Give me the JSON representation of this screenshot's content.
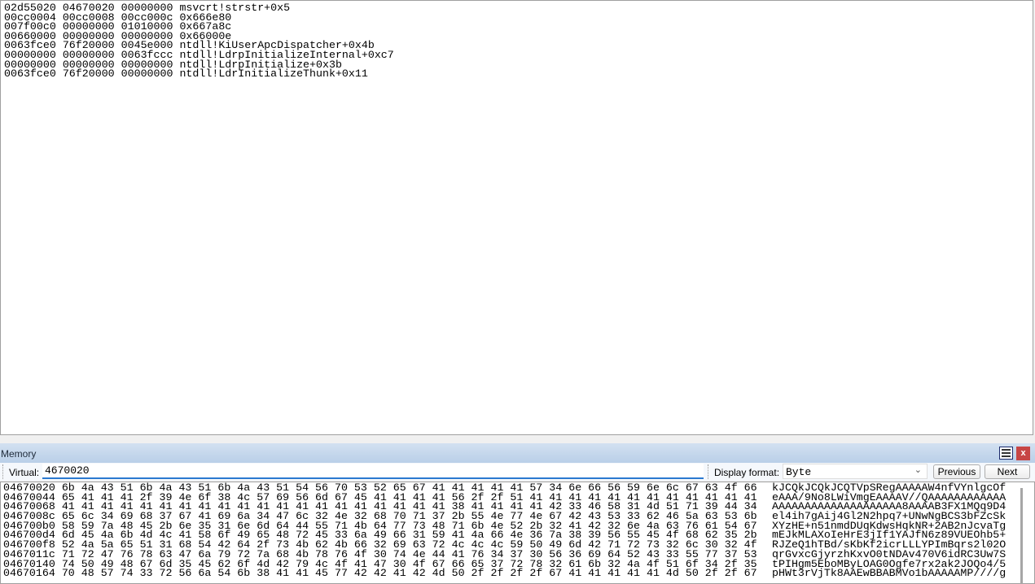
{
  "stack_pane": {
    "lines": [
      "02d55020 04670020 00000000 msvcrt!strstr+0x5",
      "00cc0004 00cc0008 00cc000c 0x666e80",
      "007f00c0 00000000 01010000 0x667a8c",
      "00660000 00000000 00000000 0x66000e",
      "0063fce0 76f20000 0045e000 ntdll!KiUserApcDispatcher+0x4b",
      "00000000 00000000 0063fccc ntdll!LdrpInitializeInternal+0xc7",
      "00000000 00000000 00000000 ntdll!LdrpInitialize+0x3b",
      "0063fce0 76f20000 00000000 ntdll!LdrInitializeThunk+0x11"
    ]
  },
  "memory_window": {
    "title": "Memory",
    "close_label": "x",
    "virtual_label": "Virtual:",
    "virtual_value": "4670020",
    "display_format_label": "Display format:",
    "display_format_value": "Byte",
    "previous_label": "Previous",
    "next_label": "Next",
    "rows": [
      {
        "addr": "04670020",
        "hex": "6b 4a 43 51 6b 4a 43 51 6b 4a 43 51 54 56 70 53 52 65 67 41 41 41 41 41 57 34 6e 66 56 59 6e 6c 67 63 4f 66",
        "ascii": "kJCQkJCQkJCQTVpSRegAAAAAW4nfVYnlgcOf"
      },
      {
        "addr": "04670044",
        "hex": "65 41 41 41 2f 39 4e 6f 38 4c 57 69 56 6d 67 45 41 41 41 41 56 2f 2f 51 41 41 41 41 41 41 41 41 41 41 41 41",
        "ascii": "eAAA/9No8LWiVmgEAAAAV//QAAAAAAAAAAAA"
      },
      {
        "addr": "04670068",
        "hex": "41 41 41 41 41 41 41 41 41 41 41 41 41 41 41 41 41 41 41 41 38 41 41 41 41 42 33 46 58 31 4d 51 71 39 44 34",
        "ascii": "AAAAAAAAAAAAAAAAAAAA8AAAAB3FX1MQq9D4"
      },
      {
        "addr": "0467008c",
        "hex": "65 6c 34 69 68 37 67 41 69 6a 34 47 6c 32 4e 32 68 70 71 37 2b 55 4e 77 4e 67 42 43 53 33 62 46 5a 63 53 6b",
        "ascii": "el4ih7gAij4Gl2N2hpq7+UNwNgBCS3bFZcSk"
      },
      {
        "addr": "046700b0",
        "hex": "58 59 7a 48 45 2b 6e 35 31 6e 6d 64 44 55 71 4b 64 77 73 48 71 6b 4e 52 2b 32 41 42 32 6e 4a 63 76 61 54 67",
        "ascii": "XYzHE+n51nmdDUqKdwsHqkNR+2AB2nJcvaTg"
      },
      {
        "addr": "046700d4",
        "hex": "6d 45 4a 6b 4d 4c 41 58 6f 49 65 48 72 45 33 6a 49 66 31 59 41 4a 66 4e 36 7a 38 39 56 55 45 4f 68 62 35 2b",
        "ascii": "mEJkMLAXoIeHrE3jIf1YAJfN6z89VUEOhb5+"
      },
      {
        "addr": "046700f8",
        "hex": "52 4a 5a 65 51 31 68 54 42 64 2f 73 4b 62 4b 66 32 69 63 72 4c 4c 4c 59 50 49 6d 42 71 72 73 32 6c 30 32 4f",
        "ascii": "RJZeQ1hTBd/sKbKf2icrLLLYPImBqrs2l02O"
      },
      {
        "addr": "0467011c",
        "hex": "71 72 47 76 78 63 47 6a 79 72 7a 68 4b 78 76 4f 30 74 4e 44 41 76 34 37 30 56 36 69 64 52 43 33 55 77 37 53",
        "ascii": "qrGvxcGjyrzhKxvO0tNDAv470V6idRC3Uw7S"
      },
      {
        "addr": "04670140",
        "hex": "74 50 49 48 67 6d 35 45 62 6f 4d 42 79 4c 4f 41 47 30 4f 67 66 65 37 72 78 32 61 6b 32 4a 4f 51 6f 34 2f 35",
        "ascii": "tPIHgm5EboMByLOAG0Ogfe7rx2ak2JOQo4/5"
      },
      {
        "addr": "04670164",
        "hex": "70 48 57 74 33 72 56 6a 54 6b 38 41 41 45 77 42 42 41 42 4d 50 2f 2f 2f 2f 67 41 41 41 41 41 4d 50 2f 2f 67",
        "ascii": "pHWt3rVjTk8AAEwBBABMVo1bAAAAAMP////g"
      }
    ]
  },
  "icons": {
    "layout": "table-layout-icon",
    "close": "close-icon",
    "dropdown": "chevron-down-icon"
  },
  "colors": {
    "title_bar": "#c4d7ee",
    "close_button": "#c74545",
    "input_underline": "#2b79d0"
  }
}
